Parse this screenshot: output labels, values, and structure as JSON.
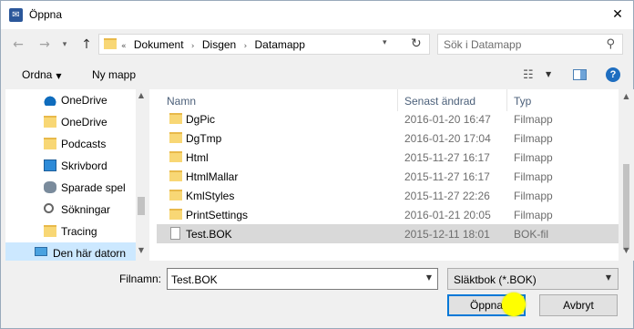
{
  "window": {
    "title": "Öppna",
    "close_glyph": "✕"
  },
  "nav": {
    "back_glyph": "←",
    "forward_glyph": "→",
    "recent_glyph": "▾",
    "up_glyph": "↑"
  },
  "address": {
    "chevron_prefix": "«",
    "crumbs": [
      "Dokument",
      "Disgen",
      "Datamapp"
    ],
    "separator": "›",
    "dropdown_glyph": "▾",
    "refresh_glyph": "↻"
  },
  "search": {
    "placeholder": "Sök i Datamapp",
    "icon_glyph": "⚲"
  },
  "toolbar": {
    "organize_label": "Ordna",
    "organize_caret": "▼",
    "new_folder_label": "Ny mapp",
    "view_glyph": "☷",
    "view_caret": "▼",
    "help_label": "?"
  },
  "sidebar": {
    "items": [
      {
        "label": "OneDrive",
        "icon": "cloud-icon"
      },
      {
        "label": "OneDrive",
        "icon": "folder-icon"
      },
      {
        "label": "Podcasts",
        "icon": "folder-icon"
      },
      {
        "label": "Skrivbord",
        "icon": "desktop-icon"
      },
      {
        "label": "Sparade spel",
        "icon": "saved-games-icon"
      },
      {
        "label": "Sökningar",
        "icon": "search-icon"
      },
      {
        "label": "Tracing",
        "icon": "folder-icon"
      },
      {
        "label": "Den här datorn",
        "icon": "computer-icon",
        "selected": true
      }
    ],
    "scroll_up": "▲",
    "scroll_down": "▼"
  },
  "filelist": {
    "columns": {
      "name": "Namn",
      "date": "Senast ändrad",
      "type": "Typ"
    },
    "sort_glyph": "^",
    "rows": [
      {
        "name": "DgPic",
        "date": "2016-01-20 16:47",
        "type": "Filmapp",
        "icon": "folder-icon"
      },
      {
        "name": "DgTmp",
        "date": "2016-01-20 17:04",
        "type": "Filmapp",
        "icon": "folder-icon"
      },
      {
        "name": "Html",
        "date": "2015-11-27 16:17",
        "type": "Filmapp",
        "icon": "folder-icon"
      },
      {
        "name": "HtmlMallar",
        "date": "2015-11-27 16:17",
        "type": "Filmapp",
        "icon": "folder-icon"
      },
      {
        "name": "KmlStyles",
        "date": "2015-11-27 22:26",
        "type": "Filmapp",
        "icon": "folder-icon"
      },
      {
        "name": "PrintSettings",
        "date": "2016-01-21 20:05",
        "type": "Filmapp",
        "icon": "folder-icon"
      },
      {
        "name": "Test.BOK",
        "date": "2015-12-11 18:01",
        "type": "BOK-fil",
        "icon": "file-icon",
        "selected": true
      }
    ],
    "scroll_up": "▲",
    "scroll_down": "▼"
  },
  "bottom": {
    "filename_label": "Filnamn:",
    "filename_value": "Test.BOK",
    "filename_dropdown": "▼",
    "filetype_value": "Släktbok (*.BOK)",
    "filetype_dropdown": "▼",
    "open_label": "Öppna",
    "cancel_label": "Avbryt"
  },
  "colors": {
    "accent": "#0078d7",
    "selection": "#cce8ff",
    "cursor_highlight": "#ffff00"
  }
}
